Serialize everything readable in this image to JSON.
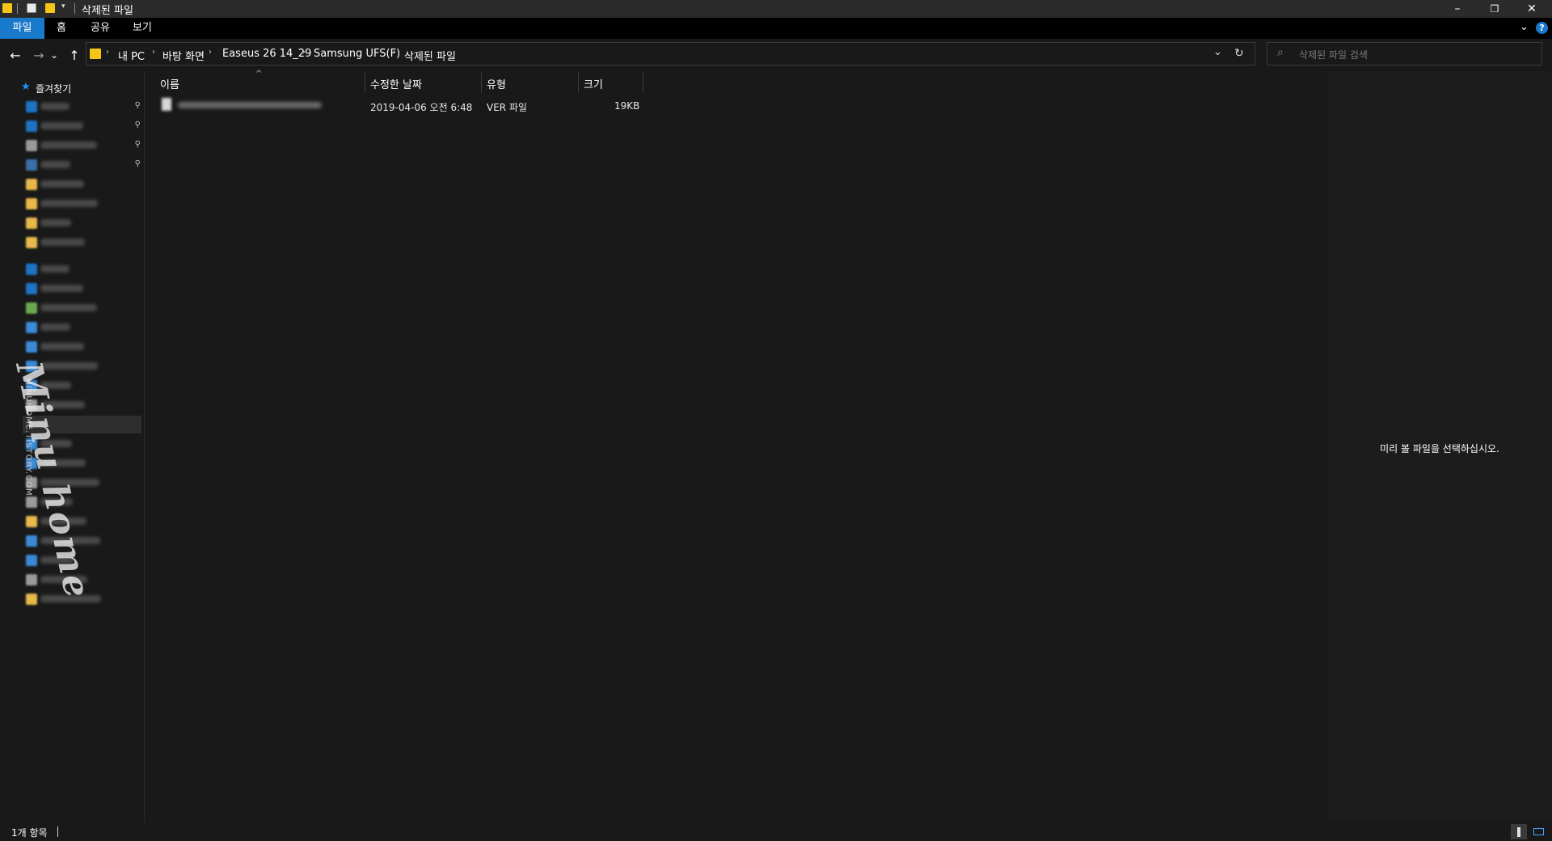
{
  "window": {
    "title": "삭제된 파일",
    "controls": {
      "minimize": "–",
      "restore": "❐",
      "close": "✕"
    }
  },
  "ribbon": {
    "tabs": [
      "파일",
      "홈",
      "공유",
      "보기"
    ],
    "expand_icon": "chevron-down-icon",
    "help_icon": "help-icon",
    "help_label": "?"
  },
  "navigation": {
    "back_glyph": "←",
    "forward_glyph": "→",
    "recent_glyph": "⌄",
    "up_glyph": "↑",
    "breadcrumb": [
      "내 PC",
      "바탕 화면",
      "Easeus 26 14_29",
      "Samsung UFS(F)",
      "삭제된 파일"
    ],
    "breadcrumb_sep": "›",
    "dropdown_glyph": "⌄",
    "refresh_glyph": "↻",
    "search_placeholder": "삭제된 파일 검색",
    "search_glyph": "⌕"
  },
  "sidebar": {
    "quick_access_label": "즐겨찾기",
    "quick_access_items": [
      {
        "icon": "desktop-icon",
        "color": "#1f73c4",
        "pinned": true
      },
      {
        "icon": "download-icon",
        "color": "#1f73c4",
        "pinned": true
      },
      {
        "icon": "document-icon",
        "color": "#9a9a9a",
        "pinned": true
      },
      {
        "icon": "picture-icon",
        "color": "#3a6fa8",
        "pinned": true
      },
      {
        "icon": "folder-icon",
        "color": "#e8b84a",
        "pinned": false
      },
      {
        "icon": "folder-icon",
        "color": "#e8b84a",
        "pinned": false
      },
      {
        "icon": "folder-icon",
        "color": "#e8b84a",
        "pinned": false
      },
      {
        "icon": "folder-icon",
        "color": "#e8b84a",
        "pinned": false
      }
    ],
    "pin_glyph": "⚲",
    "tree_items": [
      {
        "icon": "desktop-icon",
        "color": "#1f73c4"
      },
      {
        "icon": "cloud-icon",
        "color": "#1f73c4"
      },
      {
        "icon": "user-icon",
        "color": "#6aa84f"
      },
      {
        "icon": "pc-icon",
        "color": "#3a8ad6"
      },
      {
        "icon": "cube-icon",
        "color": "#3a8ad6"
      },
      {
        "icon": "download-icon",
        "color": "#3a8ad6"
      },
      {
        "icon": "music-icon",
        "color": "#3a8ad6"
      },
      {
        "icon": "document-icon",
        "color": "#9a9a9a"
      },
      {
        "icon": "desktop-icon",
        "color": "#1f73c4"
      },
      {
        "icon": "picture-icon",
        "color": "#3a8ad6"
      },
      {
        "icon": "video-icon",
        "color": "#3a8ad6"
      },
      {
        "icon": "drive-icon",
        "color": "#9a9a9a"
      },
      {
        "icon": "drive-icon",
        "color": "#9a9a9a"
      },
      {
        "icon": "library-icon",
        "color": "#e8b84a"
      },
      {
        "icon": "network-icon",
        "color": "#3a8ad6"
      },
      {
        "icon": "network-icon",
        "color": "#3a8ad6"
      },
      {
        "icon": "recycle-icon",
        "color": "#9a9a9a"
      },
      {
        "icon": "folder-icon",
        "color": "#e8b84a"
      }
    ]
  },
  "filelist": {
    "columns": {
      "name": "이름",
      "modified": "수정한 날짜",
      "type": "유형",
      "size": "크기"
    },
    "sort_glyph": "^",
    "rows": [
      {
        "modified": "2019-04-06 오전 6:48",
        "type": "VER 파일",
        "size": "19KB"
      }
    ]
  },
  "preview": {
    "message": "미리 볼 파일을 선택하십시오."
  },
  "status": {
    "item_count": "1개 항목"
  },
  "watermark": {
    "vertical_text": "MINUHOME.TISTORY.COM",
    "script_text": "Minu home"
  },
  "colors": {
    "accent": "#1979ca",
    "background": "#191919",
    "titlebar": "#2b2b2b",
    "folder": "#f5c518"
  }
}
